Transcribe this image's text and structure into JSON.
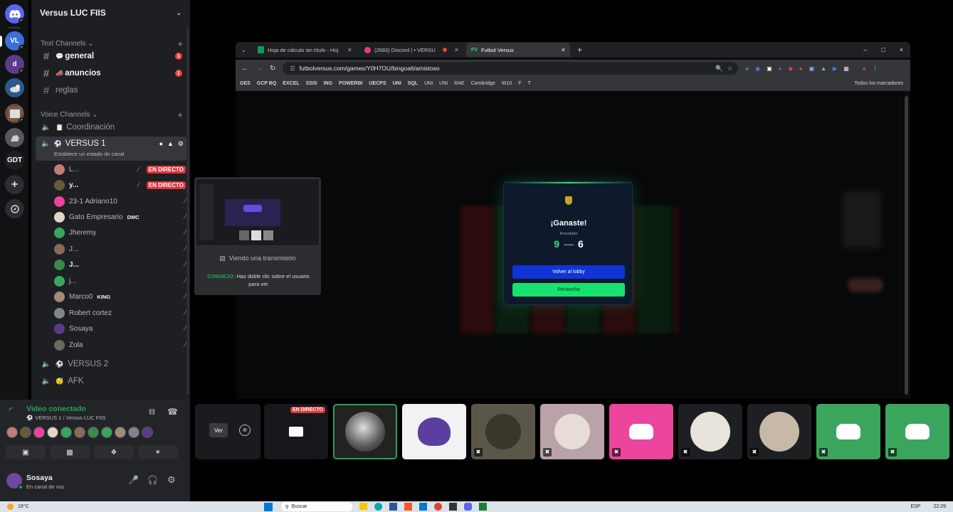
{
  "server": {
    "name": "Versus LUC FIIS"
  },
  "rail": {
    "items": [
      {
        "name": "discord-home",
        "text": "",
        "badge": "1",
        "color": "#5865f2"
      },
      {
        "name": "server-vl",
        "text": "VL",
        "badge": "2",
        "color": "#3c6fd6"
      },
      {
        "name": "server-d",
        "text": "d",
        "badge": "6",
        "color": "#5c3b8a"
      },
      {
        "name": "server-3",
        "text": "",
        "badge": "",
        "color": "#2a5a8a"
      },
      {
        "name": "server-4",
        "text": "",
        "badge": "3",
        "color": "#6a4a3a"
      },
      {
        "name": "server-5",
        "text": "",
        "badge": "",
        "color": "#55595f"
      },
      {
        "name": "server-gdt",
        "text": "GDT",
        "badge": "",
        "color": "#1e1f22"
      }
    ]
  },
  "text_channels": {
    "label": "Text Channels",
    "items": [
      {
        "name": "general",
        "unread": true,
        "badge": "1"
      },
      {
        "name": "anuncios",
        "unread": true,
        "badge": "1"
      },
      {
        "name": "reglas",
        "unread": false,
        "badge": ""
      }
    ]
  },
  "voice_channels": {
    "label": "Voice Channels",
    "items": [
      {
        "name": "Coordinación"
      },
      {
        "name": "VERSUS 1",
        "status": "Establece un estado de canal"
      },
      {
        "name": "VERSUS 2"
      },
      {
        "name": "AFK"
      }
    ]
  },
  "members": [
    {
      "name": "L...",
      "live": "EN DIRECTO",
      "color": "#c47b7b"
    },
    {
      "name": "y...",
      "live": "EN DIRECTO",
      "color": "#6a5a3a"
    },
    {
      "name": "23-1 Adriano10",
      "color": "#eb459e"
    },
    {
      "name": "Gato Empresario",
      "tag": "DMC",
      "color": "#e0d7c6"
    },
    {
      "name": "Jheremy",
      "color": "#3ba55d"
    },
    {
      "name": "J...",
      "color": "#8a6a5a"
    },
    {
      "name": "J...",
      "color": "#3a8a4a"
    },
    {
      "name": "j...",
      "color": "#3ba55d"
    },
    {
      "name": "Marco0",
      "tag": "KING",
      "color": "#a08a7a"
    },
    {
      "name": "Robert cortez",
      "color": "#80848e"
    },
    {
      "name": "Sosaya",
      "color": "#5a3a8a"
    },
    {
      "name": "Zola",
      "color": "#6a6a5a"
    }
  ],
  "voice_panel": {
    "status": "Video conectado",
    "channel": "VERSUS 1 / Versus LUC FIIS"
  },
  "user": {
    "name": "Sosaya",
    "status": "En canal de voz"
  },
  "browser": {
    "tabs": [
      {
        "title": "Hoja de cálculo sin título - Hoj"
      },
      {
        "title": "(2683) Discord | • VERSU"
      },
      {
        "title": "Futbol Versus"
      }
    ],
    "url": "futbolversus.com/games/Y0H7OU/bingoalt/amistoso",
    "bookmarks": [
      "GES",
      "GCP BQ",
      "EXCEL",
      "SSIS",
      "ING",
      "POWERBI",
      "UECPS",
      "UNI",
      "SQL",
      "UNI",
      "UNI",
      "RAE",
      "Cambridge",
      "W10",
      "F",
      "T"
    ],
    "all_bookmarks": "Todos los marcadores"
  },
  "game": {
    "title": "¡Ganaste!",
    "result_label": "Resultado",
    "score_left": "9",
    "score_sep": "—",
    "score_right": "6",
    "lobby_button": "Volver al lobby",
    "rematch_button": "Revancha"
  },
  "popup": {
    "label": "Viendo una transmisión",
    "tip_label": "CONSEJO:",
    "tip_text": "Haz doble clic sobre el usuario para ver"
  },
  "video_strip": {
    "ver_label": "Ver",
    "live_label": "EN DIRECTO"
  },
  "taskbar": {
    "weather": "19°C",
    "search": "Buscar",
    "lang": "ESP",
    "time": "22:29"
  }
}
